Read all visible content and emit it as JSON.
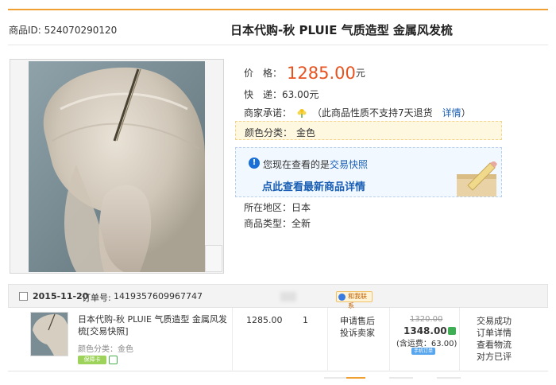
{
  "product": {
    "id_label": "商品ID: ",
    "id_value": "524070290120",
    "title": "日本代购-秋 PLUIE 气质造型 金属风发梳"
  },
  "price": {
    "label": "价　格：",
    "value": "1285.00",
    "unit": "元"
  },
  "shipping": {
    "label": "快　递：",
    "value": "63.00元"
  },
  "promise": {
    "label": "商家承诺：",
    "icon": "flower-badge-icon",
    "text": "（此商品性质不支持7天退货",
    "link": "详情",
    "close": "）"
  },
  "color": {
    "label": "颜色分类：",
    "value": "金色"
  },
  "snapshot": {
    "text_prefix": "您现在查看的是",
    "text_link": "交易快照",
    "link": "点此查看最新商品详情"
  },
  "region": {
    "label": "所在地区：",
    "value": "日本"
  },
  "type": {
    "label": "商品类型：",
    "value": "全新"
  },
  "order": {
    "date": "2015-11-20",
    "no_label": "订单号:",
    "no_value": "1419357609967747",
    "contact": "和我联系",
    "item_title": "日本代购-秋 PLUIE 气质造型 金属风发梳[交易快照]",
    "item_color": "颜色分类：金色",
    "badge_green": "保障卡",
    "unit_price": "1285.00",
    "quantity": "1",
    "after_sale_1": "申请售后",
    "after_sale_2": "投诉卖家",
    "orig_price": "1320.00",
    "paid_price": "1348.00",
    "freight": "(含运费：63.00)",
    "phone_badge": "手机订单",
    "status_1": "交易成功",
    "status_2": "订单详情",
    "status_3": "查看物流",
    "status_4": "对方已评"
  },
  "colors": {
    "accent": "#f0a030",
    "price": "#e8521f",
    "link": "#1a5fb4"
  }
}
